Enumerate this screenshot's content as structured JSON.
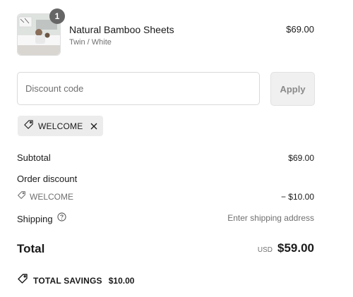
{
  "line_item": {
    "quantity": "1",
    "name": "Natural Bamboo Sheets",
    "variant": "Twin / White",
    "price": "$69.00",
    "image": "product-thumbnail-bedroom"
  },
  "discount": {
    "placeholder": "Discount code",
    "apply_label": "Apply",
    "applied_code": "WELCOME",
    "icon": "tag-icon"
  },
  "summary": {
    "subtotal_label": "Subtotal",
    "subtotal_value": "$69.00",
    "order_discount_label": "Order discount",
    "discount_code": "WELCOME",
    "discount_value": "− $10.00",
    "shipping_label": "Shipping",
    "shipping_value": "Enter shipping address",
    "total_label": "Total",
    "currency": "USD",
    "total_value": "$59.00",
    "savings_label": "TOTAL SAVINGS",
    "savings_value": "$10.00"
  },
  "colors": {
    "text": "#1a1a1a",
    "muted": "#707070",
    "chip_bg": "#ececec",
    "badge_bg": "#666666"
  }
}
